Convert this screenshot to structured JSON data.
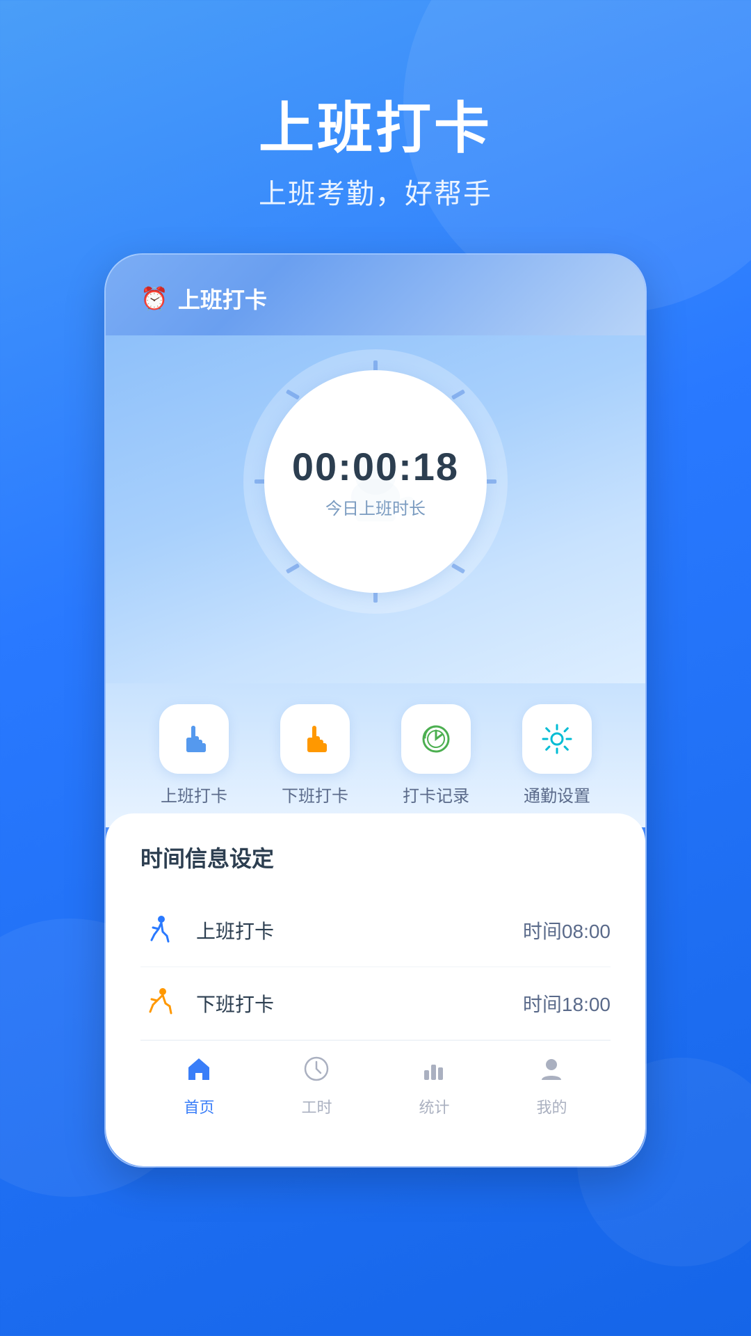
{
  "page": {
    "title": "上班打卡",
    "subtitle": "上班考勤，好帮手"
  },
  "app": {
    "name": "上班打卡",
    "clock_time": "00:00:18",
    "clock_sublabel": "今日上班时长"
  },
  "action_buttons": [
    {
      "id": "clock_in",
      "label": "上班打卡",
      "icon": "👆",
      "icon_color": "blue"
    },
    {
      "id": "clock_out",
      "label": "下班打卡",
      "icon": "👆",
      "icon_color": "orange"
    },
    {
      "id": "records",
      "label": "打卡记录",
      "icon": "🕐",
      "icon_color": "green"
    },
    {
      "id": "settings",
      "label": "通勤设置",
      "icon": "⚙️",
      "icon_color": "teal"
    }
  ],
  "settings": {
    "section_title": "时间信息设定",
    "items": [
      {
        "id": "work_in",
        "name": "上班打卡",
        "value": "时间08:00",
        "icon_type": "blue"
      },
      {
        "id": "work_out",
        "name": "下班打卡",
        "value": "时间18:00",
        "icon_type": "orange"
      }
    ]
  },
  "bottom_nav": [
    {
      "id": "home",
      "label": "首页",
      "active": true
    },
    {
      "id": "hours",
      "label": "工时",
      "active": false
    },
    {
      "id": "stats",
      "label": "统计",
      "active": false
    },
    {
      "id": "me",
      "label": "我的",
      "active": false
    }
  ]
}
